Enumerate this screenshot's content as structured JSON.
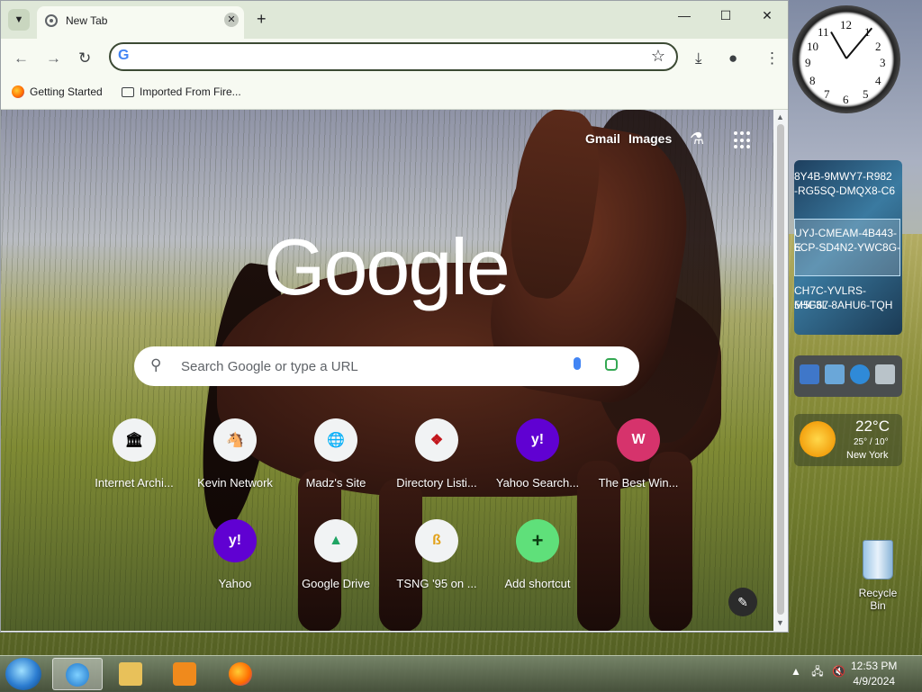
{
  "browser": {
    "tab": {
      "title": "New Tab"
    },
    "omnibox": {
      "value": "",
      "placeholder": ""
    },
    "bookmarks": [
      {
        "label": "Getting Started"
      },
      {
        "label": "Imported From Fire..."
      }
    ]
  },
  "page": {
    "links": {
      "gmail": "Gmail",
      "images": "Images"
    },
    "logo": "Google",
    "search_placeholder": "Search Google or type a URL",
    "shortcuts": [
      {
        "label": "Internet Archi...",
        "glyph": "🏛"
      },
      {
        "label": "Kevin Network",
        "glyph": "🐴"
      },
      {
        "label": "Madz's Site",
        "glyph": "🌐"
      },
      {
        "label": "Directory Listi...",
        "glyph": "❖"
      },
      {
        "label": "Yahoo Search...",
        "glyph": "y!"
      },
      {
        "label": "The Best Win...",
        "glyph": "W"
      },
      {
        "label": "Yahoo",
        "glyph": "y!"
      },
      {
        "label": "Google Drive",
        "glyph": "▲"
      },
      {
        "label": "TSNG '95 on ...",
        "glyph": "ß"
      },
      {
        "label": "Add shortcut",
        "glyph": "+"
      }
    ]
  },
  "gadgets": {
    "clock_numbers": [
      "12",
      "1",
      "2",
      "3",
      "4",
      "5",
      "6",
      "7",
      "8",
      "9",
      "10",
      "11"
    ],
    "keys": [
      "8Y4B-9MWY7-R982",
      "-RG5SQ-DMQX8-C6",
      "UYJ-CMEAM-4B443-E",
      "6CP-SD4N2-YWC8G-",
      "CH7C-YVLRS-5HG67-",
      "M5F3L-8AHU6-TQH"
    ],
    "weather": {
      "temp": "22°C",
      "range": "25° / 10°",
      "city": "New York"
    },
    "recycle_label": "Recycle Bin"
  },
  "taskbar": {
    "time": "12:53 PM",
    "date": "4/9/2024"
  }
}
